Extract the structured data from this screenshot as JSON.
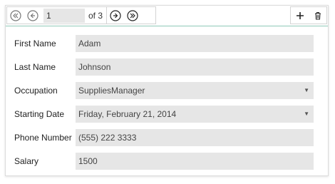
{
  "navigator": {
    "current_page": "1",
    "page_of": "of 3"
  },
  "fields": [
    {
      "label": "First Name",
      "value": "Adam",
      "type": "text"
    },
    {
      "label": "Last Name",
      "value": "Johnson",
      "type": "text"
    },
    {
      "label": "Occupation",
      "value": "SuppliesManager",
      "type": "dropdown"
    },
    {
      "label": "Starting Date",
      "value": "Friday, February 21, 2014",
      "type": "dropdown"
    },
    {
      "label": "Phone Number",
      "value": "(555) 222 3333",
      "type": "text"
    },
    {
      "label": "Salary",
      "value": "1500",
      "type": "text"
    }
  ],
  "dropdown_glyph": "▼",
  "colors": {
    "accent_line": "#8fc9b8",
    "field_bg": "#e6e6e6"
  }
}
